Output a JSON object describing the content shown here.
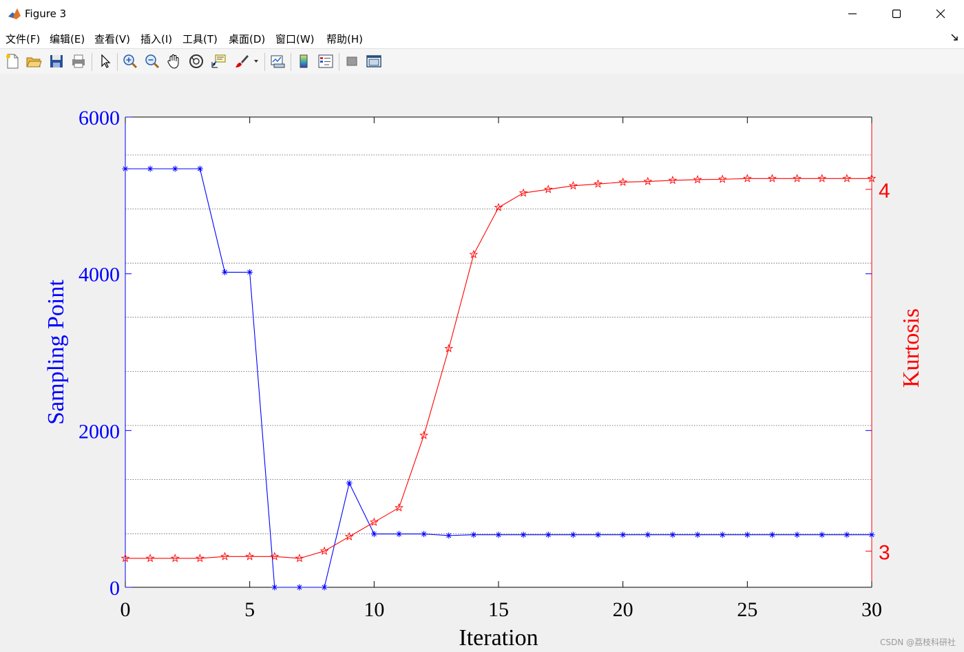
{
  "window": {
    "title": "Figure 3"
  },
  "menu": {
    "items": [
      "文件(F)",
      "编辑(E)",
      "查看(V)",
      "插入(I)",
      "工具(T)",
      "桌面(D)",
      "窗口(W)",
      "帮助(H)"
    ]
  },
  "toolbar": {
    "icons": [
      "new-figure-icon",
      "open-file-icon",
      "save-icon",
      "print-icon",
      "pointer-icon",
      "zoom-in-icon",
      "zoom-out-icon",
      "pan-hand-icon",
      "rotate-3d-icon",
      "data-cursor-icon",
      "brush-icon",
      "brush-dropdown-icon",
      "link-plot-icon",
      "colorbar-icon",
      "legend-icon",
      "hide-plot-tools-icon",
      "show-plot-tools-icon"
    ]
  },
  "colors": {
    "left_series": "#0000ff",
    "right_series": "#ff0000",
    "grid": "#555555"
  },
  "chart_data": {
    "type": "line",
    "xlabel": "Iteration",
    "ylabel_left": "Sampling Point",
    "ylabel_right": "Kurtosis",
    "xlim": [
      0,
      30
    ],
    "ylim_left": [
      0,
      6000
    ],
    "ylim_right": [
      2.9,
      4.2
    ],
    "xticks": [
      0,
      5,
      10,
      15,
      20,
      25,
      30
    ],
    "yticks_left": [
      0,
      2000,
      4000,
      6000
    ],
    "yticks_right": [
      3,
      4
    ],
    "grid": "horizontal dotted",
    "x": [
      0,
      1,
      2,
      3,
      4,
      5,
      6,
      7,
      8,
      9,
      10,
      11,
      12,
      13,
      14,
      15,
      16,
      17,
      18,
      19,
      20,
      21,
      22,
      23,
      24,
      25,
      26,
      27,
      28,
      29,
      30
    ],
    "series": [
      {
        "axis": "left",
        "marker": "asterisk",
        "values": [
          5340,
          5340,
          5340,
          5340,
          4020,
          4020,
          0,
          0,
          0,
          1330,
          680,
          680,
          680,
          660,
          670,
          670,
          670,
          670,
          670,
          670,
          670,
          670,
          670,
          670,
          670,
          670,
          670,
          670,
          670,
          670,
          670
        ]
      },
      {
        "axis": "right",
        "marker": "pentagram",
        "values": [
          2.98,
          2.98,
          2.98,
          2.98,
          2.985,
          2.985,
          2.985,
          2.98,
          3.0,
          3.04,
          3.08,
          3.12,
          3.32,
          3.56,
          3.82,
          3.95,
          3.99,
          4.0,
          4.01,
          4.015,
          4.02,
          4.022,
          4.025,
          4.027,
          4.028,
          4.03,
          4.03,
          4.03,
          4.03,
          4.03,
          4.03
        ]
      }
    ]
  },
  "watermark": "CSDN @荔枝科研社"
}
